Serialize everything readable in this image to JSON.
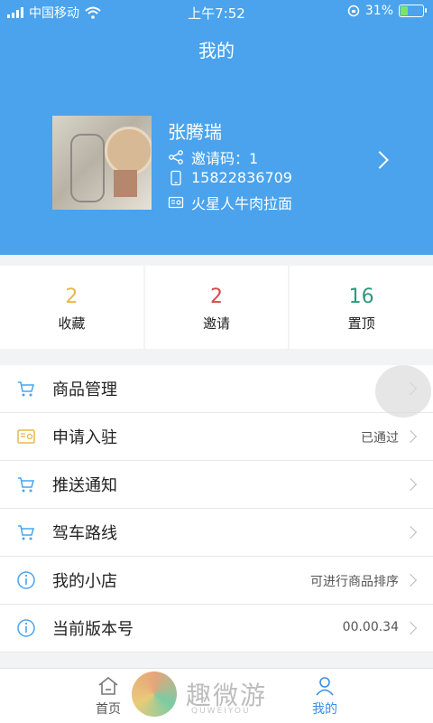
{
  "status_bar": {
    "carrier": "中国移动",
    "time": "上午7:52",
    "battery_percent": "31%",
    "battery_level": 0.31
  },
  "header": {
    "title": "我的"
  },
  "profile": {
    "name": "张腾瑞",
    "invite_code": "邀请码：1",
    "phone": "15822836709",
    "shop": "火星人牛肉拉面"
  },
  "stats": [
    {
      "value": "2",
      "label": "收藏",
      "color": "#e6b84a"
    },
    {
      "value": "2",
      "label": "邀请",
      "color": "#d64a4a"
    },
    {
      "value": "16",
      "label": "置顶",
      "color": "#2e9a7a"
    }
  ],
  "menu": [
    {
      "label": "商品管理",
      "value": "",
      "icon": "cart-icon"
    },
    {
      "label": "申请入驻",
      "value": "",
      "icon": "card-icon"
    },
    {
      "label": "推送通知",
      "value": "",
      "icon": "cart-icon"
    },
    {
      "label": "驾车路线",
      "value": "",
      "icon": "cart-icon"
    },
    {
      "label": "我的小店",
      "value": "可进行商品排序",
      "icon": "info-icon"
    },
    {
      "label": "当前版本号",
      "value": "00.00.34",
      "icon": "info-icon"
    }
  ],
  "menu_status": {
    "apply_status": "已通过"
  },
  "tabbar": {
    "home": "首页",
    "mine": "我的"
  },
  "watermark": {
    "text": "趣微游",
    "sub": "QUWEIYOU"
  },
  "colors": {
    "primary": "#4aa3ec",
    "accent_blue": "#3b8ee0"
  }
}
